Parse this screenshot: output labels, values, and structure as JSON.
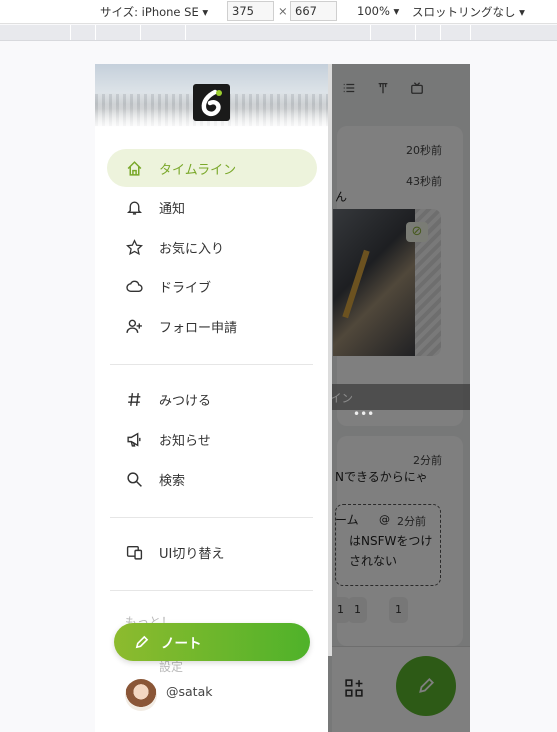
{
  "devtools": {
    "device_label": "サイズ: iPhone SE ▾",
    "width": "375",
    "times": "×",
    "height": "667",
    "zoom": "100% ▾",
    "throttle": "スロットリングなし ▾"
  },
  "underlay": {
    "times": [
      "20秒前",
      "43秒前",
      "2分前",
      "2分前"
    ],
    "note_fragment_1": "ん",
    "note_fragment_2": "Nできるからにゃ",
    "nested_header": "ーム",
    "nested_at": "@",
    "nested_line1": "はNSFWをつけ",
    "nested_line2": "されない",
    "banner_text": "このアカウントでログイン",
    "more_dots": "•••",
    "reactions": [
      "1",
      "1",
      "1"
    ]
  },
  "drawer": {
    "nav": [
      {
        "label": "タイムライン",
        "icon": "home-icon",
        "active": true
      },
      {
        "label": "通知",
        "icon": "bell-icon"
      },
      {
        "label": "お気に入り",
        "icon": "star-icon"
      },
      {
        "label": "ドライブ",
        "icon": "cloud-icon"
      },
      {
        "label": "フォロー申請",
        "icon": "user-plus-icon"
      }
    ],
    "nav2": [
      {
        "label": "みつける",
        "icon": "hash-icon"
      },
      {
        "label": "お知らせ",
        "icon": "megaphone-icon"
      },
      {
        "label": "検索",
        "icon": "search-icon"
      }
    ],
    "switch_ui": {
      "label": "UI切り替え",
      "icon": "device-icon"
    },
    "faded_more": "もっと！",
    "faded_settings": "設定",
    "note_button": "ノート",
    "account_handle": "@satak"
  },
  "colors": {
    "accent": "#86b300",
    "active_bg": "#edf3dc",
    "fab": "#5ab52c"
  }
}
